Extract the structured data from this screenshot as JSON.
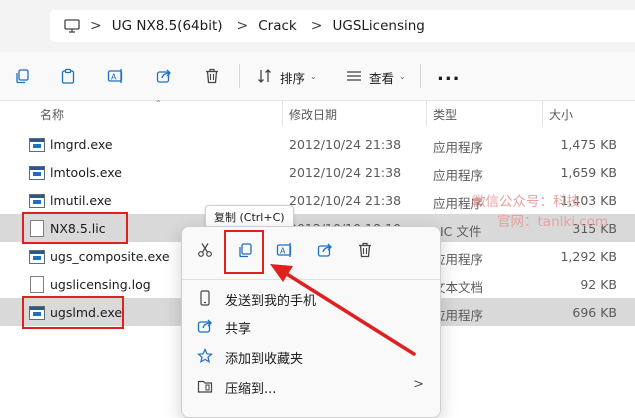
{
  "address_bar": {
    "separator": ">",
    "crumbs": [
      "UG NX8.5(64bit)",
      "Crack",
      "UGSLicensing"
    ]
  },
  "toolbar": {
    "sort_label": "排序",
    "view_label": "查看",
    "more_label": "..."
  },
  "columns": {
    "name": "名称",
    "date": "修改日期",
    "type": "类型",
    "size": "大小"
  },
  "files": [
    {
      "name": "lmgrd.exe",
      "date": "2012/10/24 21:38",
      "type": "应用程序",
      "size": "1,475 KB",
      "icon": "exe-icon"
    },
    {
      "name": "lmtools.exe",
      "date": "2012/10/24 21:38",
      "type": "应用程序",
      "size": "1,659 KB",
      "icon": "exe-icon"
    },
    {
      "name": "lmutil.exe",
      "date": "2012/10/24 21:38",
      "type": "应用程序",
      "size": "1,403 KB",
      "icon": "exe-icon"
    },
    {
      "name": "NX8.5.lic",
      "date": "2012/10/10 18:10",
      "type": "LIC 文件",
      "size": "315 KB",
      "icon": "document-icon"
    },
    {
      "name": "ugs_composite.exe",
      "date": "",
      "type": "应用程序",
      "size": "1,292 KB",
      "icon": "exe-icon"
    },
    {
      "name": "ugslicensing.log",
      "date": "",
      "type": "文本文档",
      "size": "92 KB",
      "icon": "document-icon"
    },
    {
      "name": "ugslmd.exe",
      "date": "",
      "type": "应用程序",
      "size": "696 KB",
      "icon": "exe-icon"
    }
  ],
  "tooltip": "复制 (Ctrl+C)",
  "context_menu": {
    "items": [
      {
        "label": "发送到我的手机",
        "icon": "phone-icon"
      },
      {
        "label": "共享",
        "icon": "share-icon"
      },
      {
        "label": "添加到收藏夹",
        "icon": "star-icon"
      },
      {
        "label": "压缩到...",
        "icon": "zip-folder-icon"
      }
    ],
    "submenu_chevron": ">"
  },
  "watermark": {
    "line1": "微信公众号：科技",
    "line2": "官网：tanlki.com"
  },
  "colors": {
    "highlight_red": "#e02020",
    "selection_gray": "#d9d9d9",
    "accent_blue": "#005fb8"
  }
}
